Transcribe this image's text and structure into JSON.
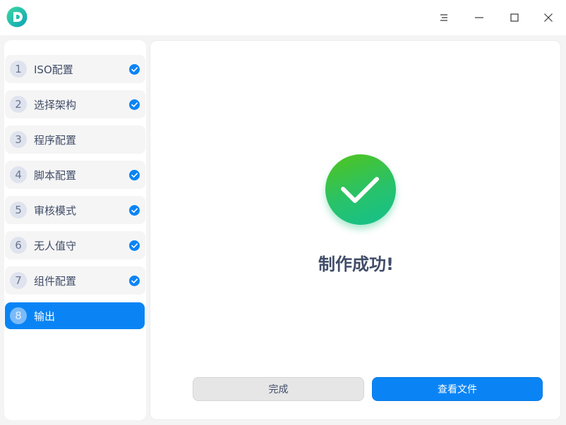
{
  "window": {
    "logo_icon": "deepin-iso-app-logo-icon",
    "menu_icon": "menu-icon",
    "minimize_icon": "minimize-icon",
    "maximize_icon": "maximize-icon",
    "close_icon": "close-icon"
  },
  "sidebar": {
    "steps": [
      {
        "number": "1",
        "label": "ISO配置",
        "completed": true
      },
      {
        "number": "2",
        "label": "选择架构",
        "completed": true
      },
      {
        "number": "3",
        "label": "程序配置",
        "completed": false
      },
      {
        "number": "4",
        "label": "脚本配置",
        "completed": true
      },
      {
        "number": "5",
        "label": "审核模式",
        "completed": true
      },
      {
        "number": "6",
        "label": "无人值守",
        "completed": true
      },
      {
        "number": "7",
        "label": "组件配置",
        "completed": true
      },
      {
        "number": "8",
        "label": "输出",
        "completed": false,
        "active": true
      }
    ]
  },
  "main": {
    "status_icon": "success-check-icon",
    "status_text": "制作成功!",
    "done_button": "完成",
    "view_files_button": "查看文件"
  },
  "colors": {
    "accent": "#0a84f5",
    "success_green": "#28c26a",
    "text": "#414d68"
  }
}
